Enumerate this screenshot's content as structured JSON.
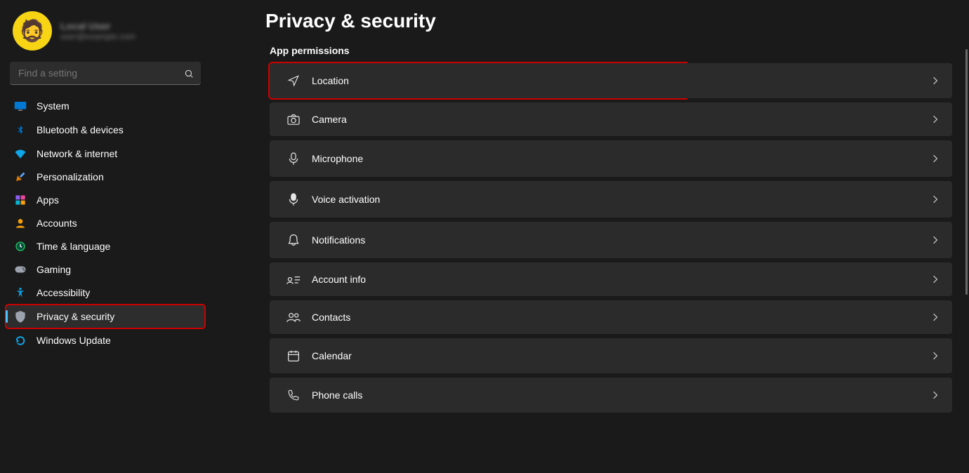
{
  "user": {
    "name": "Local User",
    "email": "user@example.com"
  },
  "search": {
    "placeholder": "Find a setting"
  },
  "nav": [
    {
      "label": "System",
      "icon": "system"
    },
    {
      "label": "Bluetooth & devices",
      "icon": "bluetooth"
    },
    {
      "label": "Network & internet",
      "icon": "network"
    },
    {
      "label": "Personalization",
      "icon": "personalization"
    },
    {
      "label": "Apps",
      "icon": "apps"
    },
    {
      "label": "Accounts",
      "icon": "accounts"
    },
    {
      "label": "Time & language",
      "icon": "time"
    },
    {
      "label": "Gaming",
      "icon": "gaming"
    },
    {
      "label": "Accessibility",
      "icon": "accessibility"
    },
    {
      "label": "Privacy & security",
      "icon": "privacy",
      "selected": true,
      "highlighted": true
    },
    {
      "label": "Windows Update",
      "icon": "update"
    }
  ],
  "page": {
    "title": "Privacy & security",
    "section": "App permissions"
  },
  "permissions": [
    {
      "label": "Location",
      "icon": "location",
      "highlighted": true
    },
    {
      "label": "Camera",
      "icon": "camera"
    },
    {
      "label": "Microphone",
      "icon": "microphone"
    },
    {
      "label": "Voice activation",
      "icon": "voice"
    },
    {
      "label": "Notifications",
      "icon": "notifications"
    },
    {
      "label": "Account info",
      "icon": "accountinfo"
    },
    {
      "label": "Contacts",
      "icon": "contacts"
    },
    {
      "label": "Calendar",
      "icon": "calendar"
    },
    {
      "label": "Phone calls",
      "icon": "phone"
    }
  ]
}
